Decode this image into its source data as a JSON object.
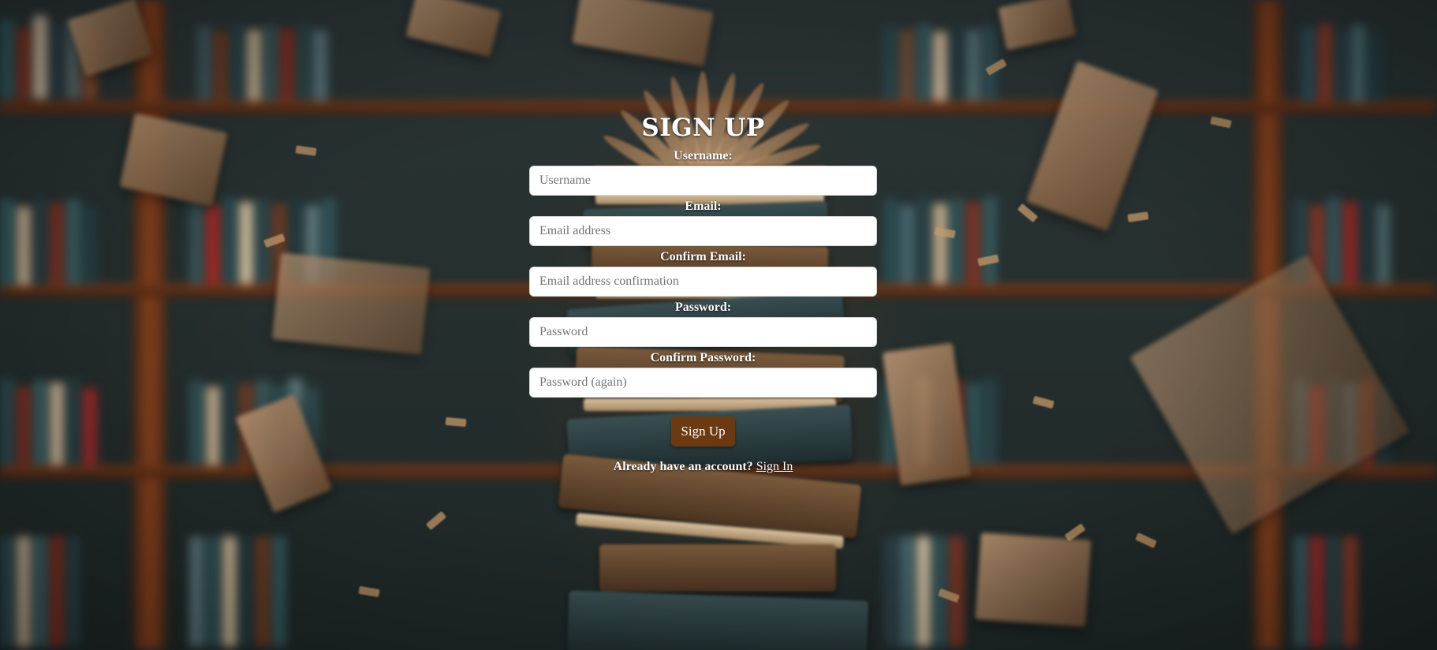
{
  "page": {
    "title": "SIGN UP",
    "accent_color": "#6b3a13",
    "background_image": "library-with-flying-books"
  },
  "form": {
    "fields": [
      {
        "label": "Username:",
        "placeholder": "Username",
        "value": ""
      },
      {
        "label": "Email:",
        "placeholder": "Email address",
        "value": ""
      },
      {
        "label": "Confirm Email:",
        "placeholder": "Email address confirmation",
        "value": ""
      },
      {
        "label": "Password:",
        "placeholder": "Password",
        "value": ""
      },
      {
        "label": "Confirm Password:",
        "placeholder": "Password (again)",
        "value": ""
      }
    ],
    "submit_label": "Sign Up"
  },
  "footer": {
    "prompt": "Already have an account?",
    "link_label": "Sign In"
  }
}
